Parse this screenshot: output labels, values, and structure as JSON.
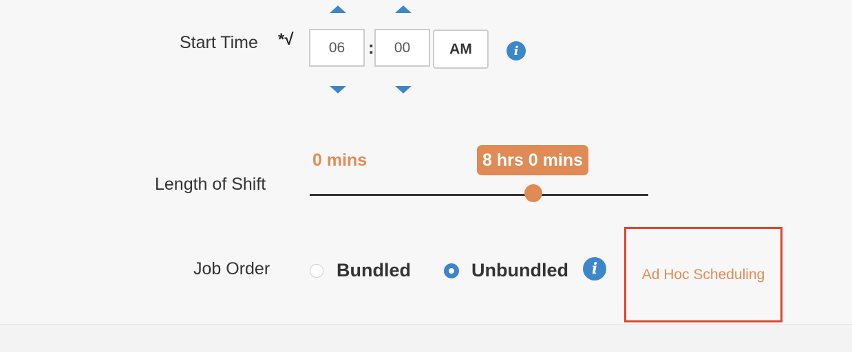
{
  "start_time": {
    "label": "Start Time",
    "required_marker": "*√",
    "hour": "06",
    "separator": ":",
    "minute": "00",
    "ampm": "AM",
    "info_glyph": "i"
  },
  "length_of_shift": {
    "label": "Length of Shift",
    "min_label": "0 mins",
    "current_label": "8 hrs 0 mins",
    "value_fraction": 0.66
  },
  "job_order": {
    "label": "Job Order",
    "options": [
      {
        "label": "Bundled",
        "selected": false
      },
      {
        "label": "Unbundled",
        "selected": true
      }
    ],
    "info_glyph": "i"
  },
  "ad_hoc": {
    "label": "Ad Hoc Scheduling"
  },
  "colors": {
    "accent_blue": "#3d86c9",
    "accent_orange": "#e08a55",
    "highlight_red": "#e0442e",
    "background": "#f7f7f7"
  },
  "icons": {
    "hour_up": "triangle-up",
    "hour_down": "triangle-down",
    "minute_up": "triangle-up",
    "minute_down": "triangle-down",
    "info": "info-circle"
  }
}
